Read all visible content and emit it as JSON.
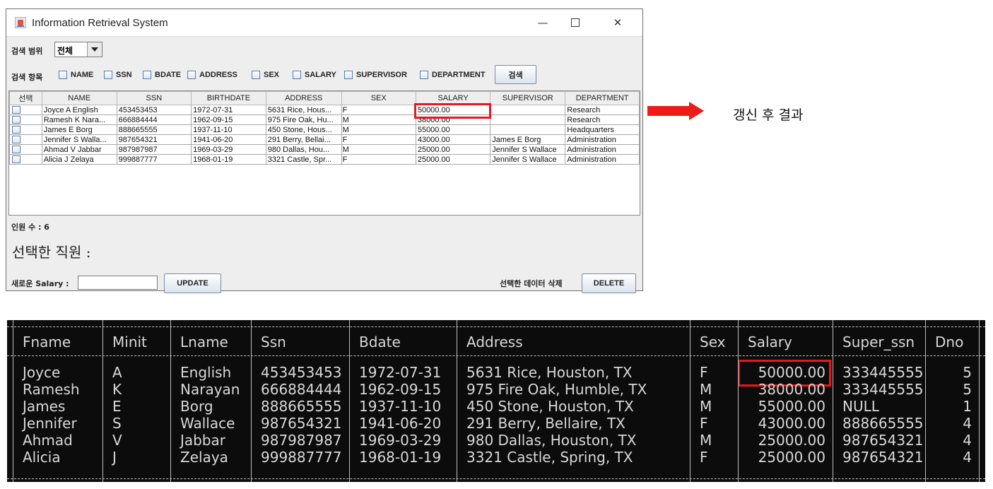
{
  "window": {
    "title": "Information Retrieval System",
    "controls": {
      "minimize": "—",
      "close": "✕"
    }
  },
  "filters": {
    "scope_label": "검색 범위",
    "scope_value": "전체",
    "fields_label": "검색 항목",
    "checkboxes": [
      "NAME",
      "SSN",
      "BDATE",
      "ADDRESS",
      "SEX",
      "SALARY",
      "SUPERVISOR",
      "DEPARTMENT"
    ],
    "search_button": "검색"
  },
  "table": {
    "columns": [
      "선택",
      "NAME",
      "SSN",
      "BIRTHDATE",
      "ADDRESS",
      "SEX",
      "SALARY",
      "SUPERVISOR",
      "DEPARTMENT"
    ],
    "rows": [
      [
        "Joyce A English",
        "453453453",
        "1972-07-31",
        "5631 Rice, Hous...",
        "F",
        "50000.00",
        "",
        "Research"
      ],
      [
        "Ramesh K Nara...",
        "666884444",
        "1962-09-15",
        "975 Fire Oak, Hu...",
        "M",
        "38000.00",
        "",
        "Research"
      ],
      [
        "James E Borg",
        "888665555",
        "1937-11-10",
        "450 Stone, Hous...",
        "M",
        "55000.00",
        "",
        "Headquarters"
      ],
      [
        "Jennifer S Walla...",
        "987654321",
        "1941-06-20",
        "291 Berry, Bellai...",
        "F",
        "43000.00",
        "James E Borg",
        "Administration"
      ],
      [
        "Ahmad V Jabbar",
        "987987987",
        "1969-03-29",
        "980 Dallas, Hou...",
        "M",
        "25000.00",
        "Jennifer S Wallace",
        "Administration"
      ],
      [
        "Alicia J Zelaya",
        "999887777",
        "1968-01-19",
        "3321 Castle, Spr...",
        "F",
        "25000.00",
        "Jennifer S Wallace",
        "Administration"
      ]
    ]
  },
  "footer": {
    "count_label": "인원 수 : 6",
    "selected_label": "선택한 직원 :",
    "new_salary_label": "새로운 Salary :",
    "new_salary_value": "",
    "update_button": "UPDATE",
    "delete_label": "선택한 데이터 삭제",
    "delete_button": "DELETE"
  },
  "annotation": {
    "caption": "갱신 후 결과",
    "highlight_color": "#e8161d"
  },
  "console": {
    "columns": [
      "Fname",
      "Minit",
      "Lname",
      "Ssn",
      "Bdate",
      "Address",
      "Sex",
      "Salary",
      "Super_ssn",
      "Dno"
    ],
    "rows": [
      [
        "Joyce",
        "A",
        "English",
        "453453453",
        "1972-07-31",
        "5631 Rice, Houston, TX",
        "F",
        "50000.00",
        "333445555",
        "5"
      ],
      [
        "Ramesh",
        "K",
        "Narayan",
        "666884444",
        "1962-09-15",
        "975 Fire Oak, Humble, TX",
        "M",
        "38000.00",
        "333445555",
        "5"
      ],
      [
        "James",
        "E",
        "Borg",
        "888665555",
        "1937-11-10",
        "450 Stone, Houston, TX",
        "M",
        "55000.00",
        "NULL",
        "1"
      ],
      [
        "Jennifer",
        "S",
        "Wallace",
        "987654321",
        "1941-06-20",
        "291 Berry, Bellaire, TX",
        "F",
        "43000.00",
        "888665555",
        "4"
      ],
      [
        "Ahmad",
        "V",
        "Jabbar",
        "987987987",
        "1969-03-29",
        "980 Dallas, Houston, TX",
        "M",
        "25000.00",
        "987654321",
        "4"
      ],
      [
        "Alicia",
        "J",
        "Zelaya",
        "999887777",
        "1968-01-19",
        "3321 Castle, Spring, TX",
        "F",
        "25000.00",
        "987654321",
        "4"
      ]
    ]
  }
}
